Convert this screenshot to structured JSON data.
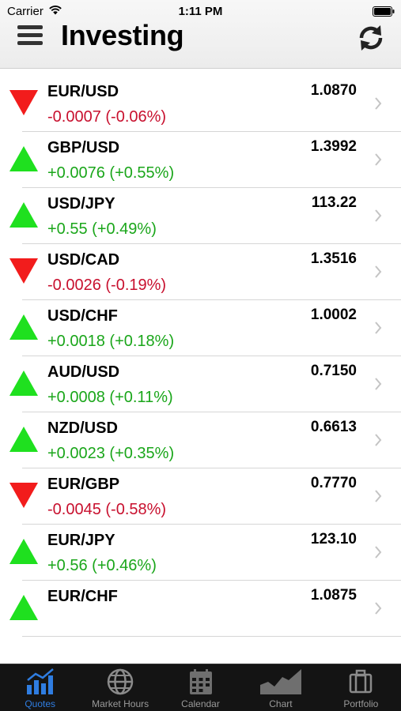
{
  "status_bar": {
    "carrier": "Carrier",
    "time": "1:11 PM"
  },
  "header": {
    "title": "Investing",
    "menu_icon": "menu-icon",
    "refresh_icon": "refresh-icon"
  },
  "colors": {
    "up": "#1fe01f",
    "down": "#f21c1c",
    "up_text": "#1aa61a",
    "down_text": "#c8102e",
    "tab_active": "#2f7de1"
  },
  "quotes": [
    {
      "pair": "EUR/USD",
      "rate": "1.0870",
      "change": "-0.0007 (-0.06%)",
      "direction": "down"
    },
    {
      "pair": "GBP/USD",
      "rate": "1.3992",
      "change": "+0.0076 (+0.55%)",
      "direction": "up"
    },
    {
      "pair": "USD/JPY",
      "rate": "113.22",
      "change": "+0.55 (+0.49%)",
      "direction": "up"
    },
    {
      "pair": "USD/CAD",
      "rate": "1.3516",
      "change": "-0.0026 (-0.19%)",
      "direction": "down"
    },
    {
      "pair": "USD/CHF",
      "rate": "1.0002",
      "change": "+0.0018 (+0.18%)",
      "direction": "up"
    },
    {
      "pair": "AUD/USD",
      "rate": "0.7150",
      "change": "+0.0008 (+0.11%)",
      "direction": "up"
    },
    {
      "pair": "NZD/USD",
      "rate": "0.6613",
      "change": "+0.0023 (+0.35%)",
      "direction": "up"
    },
    {
      "pair": "EUR/GBP",
      "rate": "0.7770",
      "change": "-0.0045 (-0.58%)",
      "direction": "down"
    },
    {
      "pair": "EUR/JPY",
      "rate": "123.10",
      "change": "+0.56 (+0.46%)",
      "direction": "up"
    },
    {
      "pair": "EUR/CHF",
      "rate": "1.0875",
      "change": "",
      "direction": "up"
    }
  ],
  "tab_bar": {
    "tabs": [
      {
        "label": "Quotes",
        "icon": "quotes-chart-icon",
        "active": true
      },
      {
        "label": "Market Hours",
        "icon": "globe-icon",
        "active": false
      },
      {
        "label": "Calendar",
        "icon": "calendar-icon",
        "active": false
      },
      {
        "label": "Chart",
        "icon": "area-chart-icon",
        "active": false
      },
      {
        "label": "Portfolio",
        "icon": "briefcase-icon",
        "active": false
      }
    ]
  }
}
